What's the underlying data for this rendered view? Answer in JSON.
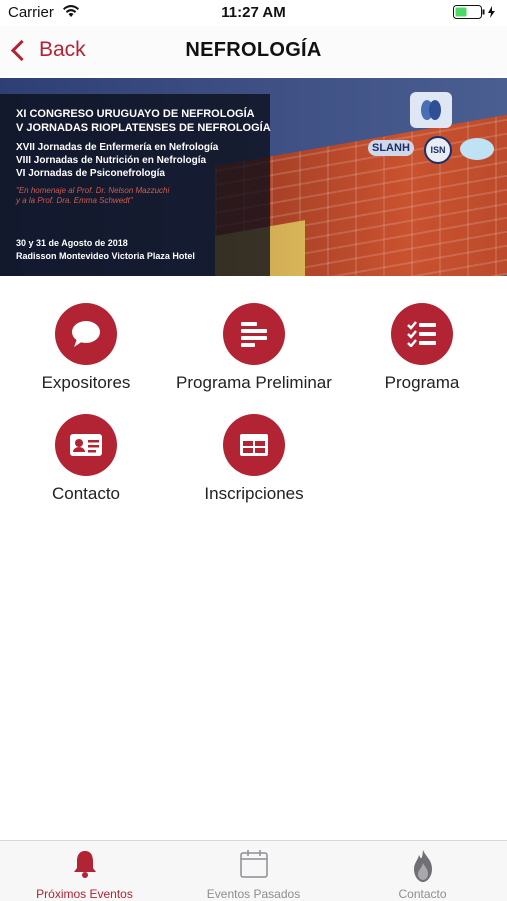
{
  "status_bar": {
    "carrier": "Carrier",
    "time": "11:27 AM"
  },
  "navbar": {
    "back_label": "Back",
    "title": "NEFROLOGÍA"
  },
  "banner": {
    "line1": "XI CONGRESO URUGUAYO DE NEFROLOGÍA",
    "line2": "V JORNADAS RIOPLATENSES DE NEFROLOGÍA",
    "line3": "XVII Jornadas de Enfermería en Nefrología",
    "line4": "VIII Jornadas de Nutrición en Nefrología",
    "line5": "VI Jornadas de Psiconefrología",
    "tribute1": "\"En homenaje al Prof. Dr. Nelson Mazzuchi",
    "tribute2": "y a la Prof. Dra. Emma Schwedt\"",
    "dates": "30 y 31 de Agosto de 2018",
    "venue": "Radisson Montevideo Victoria Plaza Hotel",
    "logo_slanh": "SLANH",
    "logo_isn": "ISN"
  },
  "menu": {
    "expositores": "Expositores",
    "programa_preliminar": "Programa Preliminar",
    "programa": "Programa",
    "contacto": "Contacto",
    "inscripciones": "Inscripciones"
  },
  "tabbar": {
    "tab1": "Próximos Eventos",
    "tab2": "Eventos Pasados",
    "tab3": "Contacto"
  },
  "colors": {
    "accent": "#b22333",
    "banner_blue": "#3a4c80"
  }
}
